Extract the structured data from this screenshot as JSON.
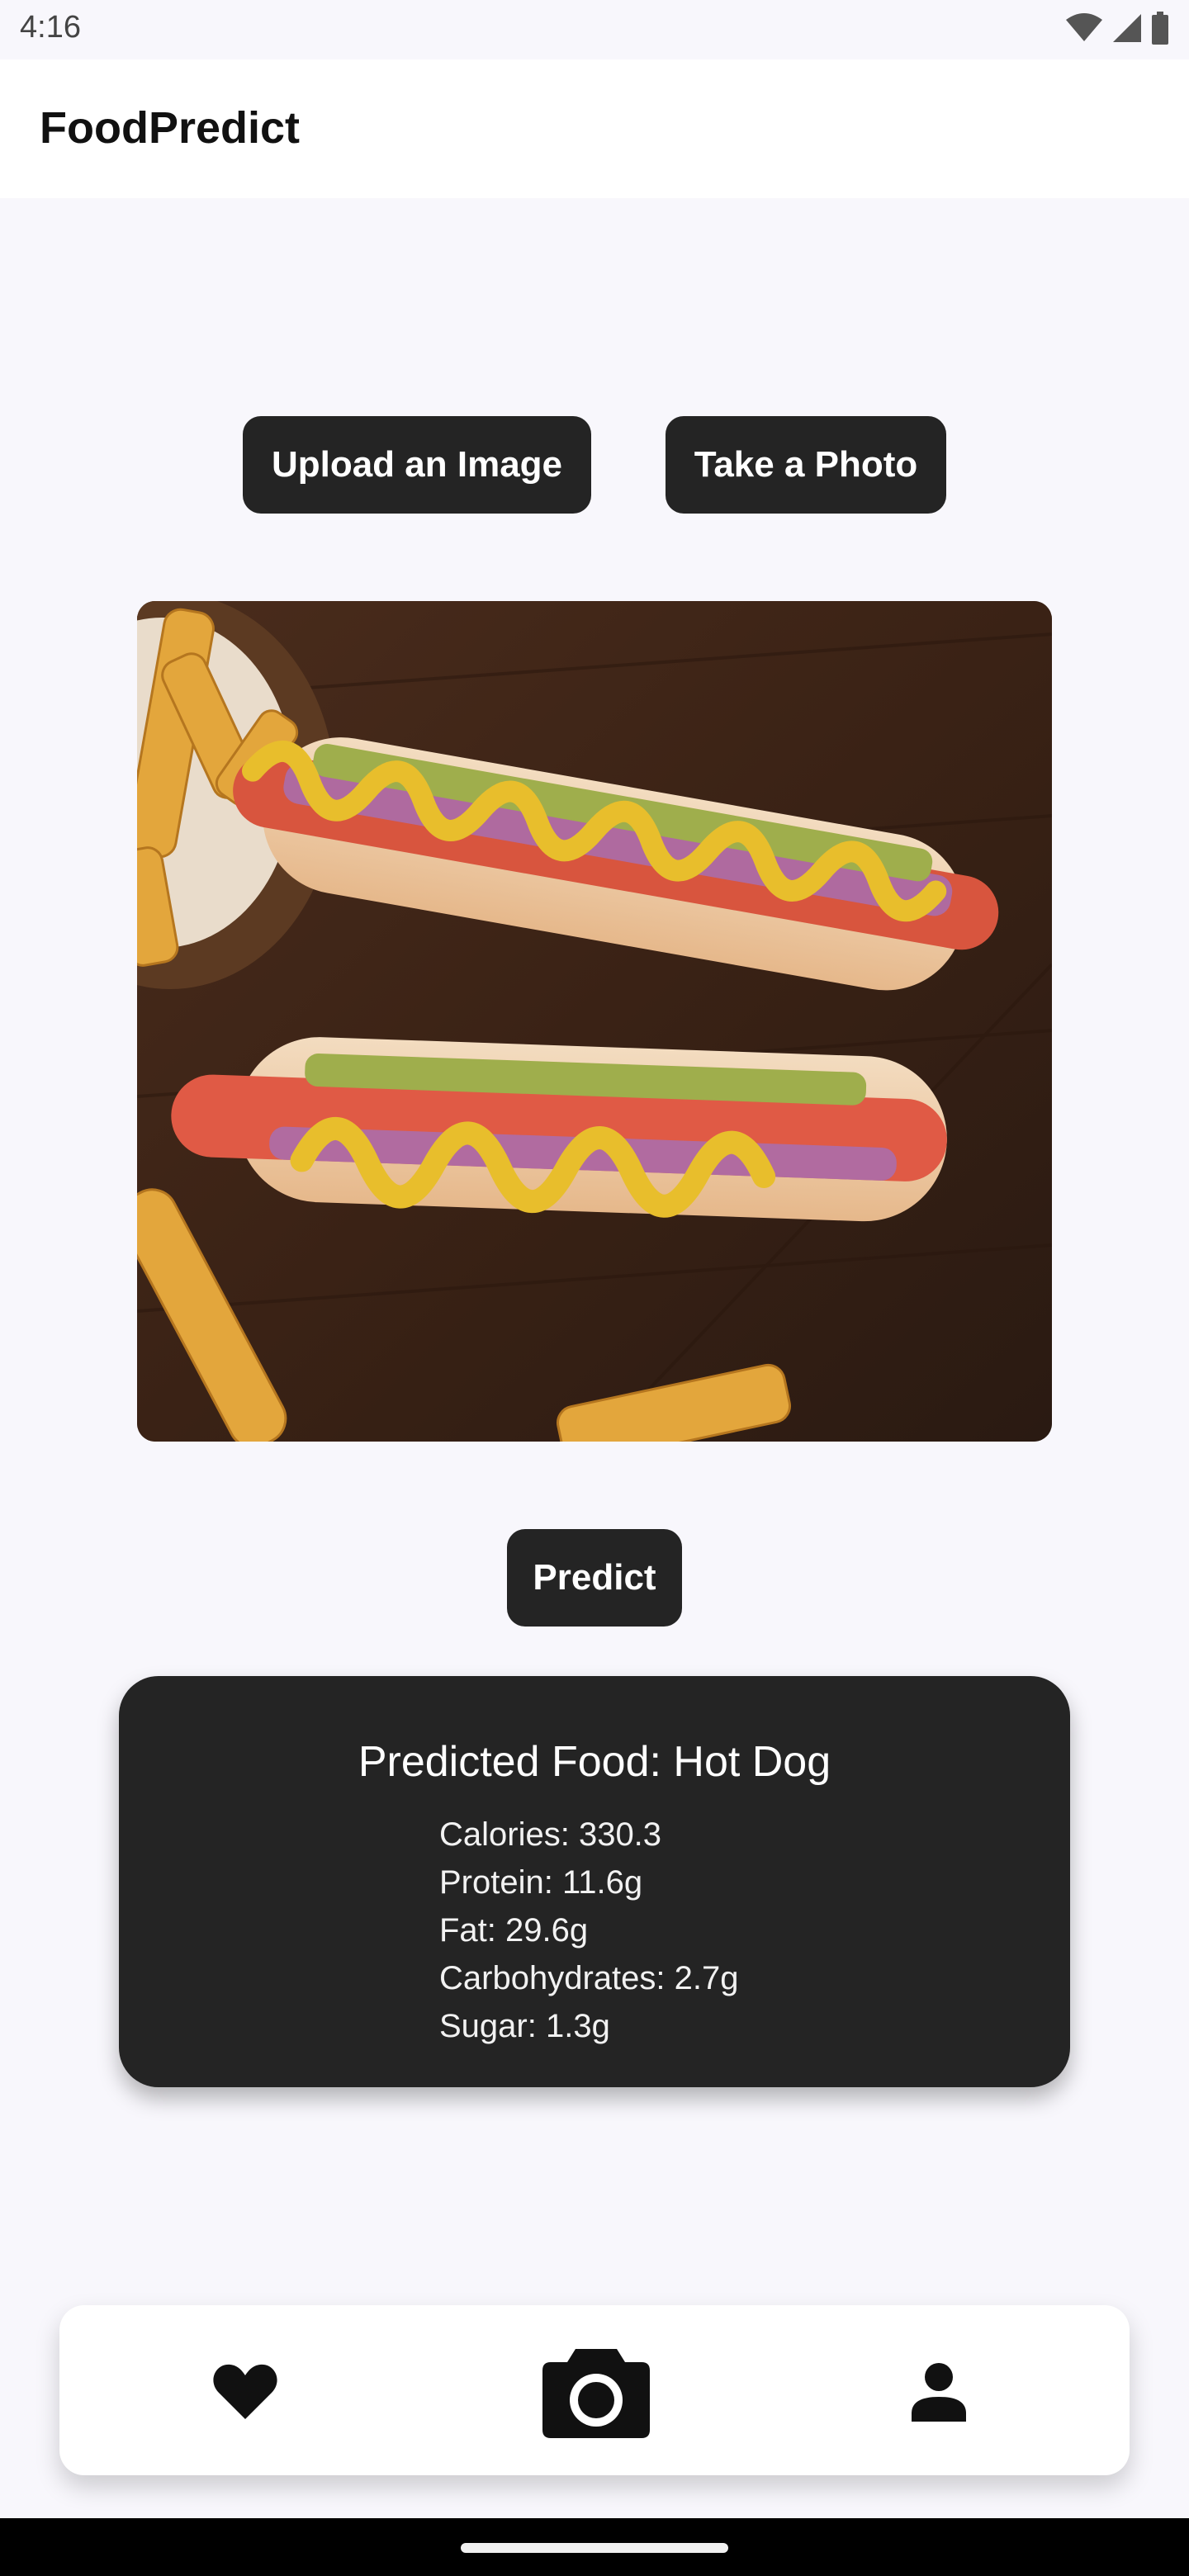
{
  "status_bar": {
    "time": "4:16",
    "icons": [
      "wifi-icon",
      "signal-icon",
      "battery-icon"
    ]
  },
  "app_bar": {
    "title": "FoodPredict"
  },
  "actions": {
    "upload_label": "Upload an Image",
    "photo_label": "Take a Photo",
    "predict_label": "Predict"
  },
  "image": {
    "subject": "hot dogs with mustard, ketchup, onions and relish beside fries"
  },
  "result": {
    "title": "Predicted Food: Hot Dog",
    "nutrients": [
      "Calories: 330.3",
      "Protein: 11.6g",
      "Fat: 29.6g",
      "Carbohydrates: 2.7g",
      "Sugar: 1.3g"
    ]
  },
  "bottom_nav": {
    "items": [
      "heart-icon",
      "camera-icon",
      "person-icon"
    ]
  },
  "colors": {
    "background": "#f8f7fc",
    "button": "#242424",
    "card": "#242424",
    "text_light": "#ffffff"
  }
}
